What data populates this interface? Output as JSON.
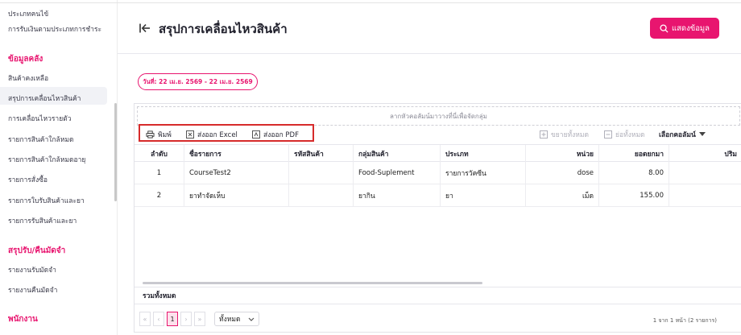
{
  "sidebar": {
    "items_top": [
      "ประเภทคนไข้",
      "การรับเงินตามประเภทการชำระ"
    ],
    "section_inventory": "ข้อมูลคลัง",
    "inventory_items": [
      "สินค้าคงเหลือ",
      "สรุปการเคลื่อนไหวสินค้า",
      "การเคลื่อนไหวรายตัว",
      "รายการสินค้าใกล้หมด",
      "รายการสินค้าใกล้หมดอายุ",
      "รายการสั่งซื้อ",
      "รายการใบรับสินค้าและยา",
      "รายการรับสินค้าและยา"
    ],
    "section_deposit": "สรุปรับ/คืนมัดจำ",
    "deposit_items": [
      "รายงานรับมัดจำ",
      "รายงานคืนมัดจำ"
    ],
    "section_staff": "พนักงาน"
  },
  "header": {
    "title": "สรุปการเคลื่อนไหวสินค้า",
    "show_button": "แสดงข้อมูล"
  },
  "date_range": "วันที่: 22 เม.ย. 2569 - 22 เม.ย. 2569",
  "grid": {
    "group_panel": "ลากหัวคอลัมน์มาวางที่นี่เพื่อจัดกลุ่ม",
    "toolbar": {
      "print": "พิมพ์",
      "export_excel": "ส่งออก Excel",
      "export_pdf": "ส่งออก PDF",
      "expand_all": "ขยายทั้งหมด",
      "collapse_all": "ย่อทั้งหมด",
      "column_chooser": "เลือกคอลัมน์"
    },
    "columns": [
      "ลำดับ",
      "ชื่อรายการ",
      "รหัสสินค้า",
      "กลุ่มสินค้า",
      "ประเภท",
      "หน่วย",
      "ยอดยกมา",
      "ปริม"
    ],
    "rows": [
      {
        "no": "1",
        "name": "CourseTest2",
        "code": "",
        "group": "Food-Suplement",
        "type": "รายการวัคซีน",
        "unit": "dose",
        "carried": "8.00"
      },
      {
        "no": "2",
        "name": "ยาทำจัดเห็บ",
        "code": "",
        "group": "ยากิน",
        "type": "ยา",
        "unit": "เม็ด",
        "carried": "155.00"
      }
    ],
    "summary": "รวมทั้งหมด",
    "pager": {
      "first": "«",
      "prev": "‹",
      "current": "1",
      "next": "›",
      "last": "»",
      "page_size": "ทั้งหมด",
      "info": "1 จาก 1 หน้า (2 รายการ)"
    }
  },
  "colors": {
    "accent": "#e8156f",
    "highlight": "#d62b2b"
  }
}
